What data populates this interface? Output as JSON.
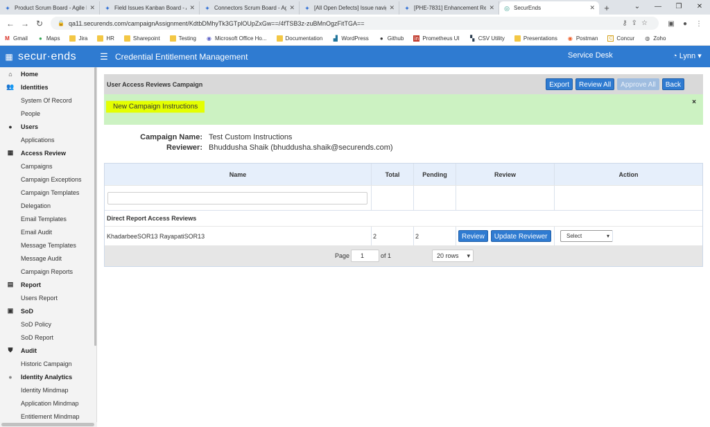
{
  "browser": {
    "tabs": [
      {
        "title": "Product Scrum Board - Agile Bo",
        "icon": "jira-icon"
      },
      {
        "title": "Field Issues Kanban Board - Agi",
        "icon": "jira-icon"
      },
      {
        "title": "Connectors Scrum Board - Agile",
        "icon": "jira-icon"
      },
      {
        "title": "[All Open Defects] Issue navigat",
        "icon": "jira-icon"
      },
      {
        "title": "[PHE-7831] Enhancement Reque",
        "icon": "jira-icon"
      },
      {
        "title": "SecurEnds",
        "icon": "securends-icon",
        "active": true
      }
    ],
    "url": "qa11.securends.com/campaignAssignment/KdtbDMhyTk3GTplOUpZxGw==/4fTSB3z-zuBMnOgzFitTGA==",
    "bookmarks": [
      "Gmail",
      "Maps",
      "Jira",
      "HR",
      "Sharepoint",
      "Testing",
      "Microsoft Office Ho...",
      "Documentation",
      "WordPress",
      "Github",
      "Prometheus UI",
      "CSV Utility",
      "Presentations",
      "Postman",
      "Concur",
      "Zoho"
    ]
  },
  "header": {
    "logo": "secur·ends",
    "title": "Credential Entitlement Management",
    "service_desk": "Service Desk",
    "user": "Lynn"
  },
  "sidebar": {
    "home": "Home",
    "identities": "Identities",
    "system_of_record": "System Of Record",
    "people": "People",
    "users": "Users",
    "applications": "Applications",
    "access_review": "Access Review",
    "campaigns": "Campaigns",
    "campaign_exceptions": "Campaign Exceptions",
    "campaign_templates": "Campaign Templates",
    "delegation": "Delegation",
    "email_templates": "Email Templates",
    "email_audit": "Email Audit",
    "message_templates": "Message Templates",
    "message_audit": "Message Audit",
    "campaign_reports": "Campaign Reports",
    "report": "Report",
    "users_report": "Users Report",
    "sod": "SoD",
    "sod_policy": "SoD Policy",
    "sod_report": "SoD Report",
    "audit": "Audit",
    "historic_campaign": "Historic Campaign",
    "identity_analytics": "Identity Analytics",
    "identity_mindmap": "Identity Mindmap",
    "application_mindmap": "Application Mindmap",
    "entitlement_mindmap": "Entitlement Mindmap"
  },
  "panel": {
    "title": "User Access Reviews Campaign",
    "export": "Export",
    "review_all": "Review All",
    "approve_all": "Approve All",
    "back": "Back"
  },
  "instructions": {
    "label": "New Campaign Instructions",
    "close": "×"
  },
  "campaign": {
    "name_label": "Campaign Name:",
    "name_value": "Test Custom Instructions",
    "reviewer_label": "Reviewer:",
    "reviewer_value": "Bhuddusha Shaik (bhuddusha.shaik@securends.com)"
  },
  "table": {
    "columns": [
      "Name",
      "Total",
      "Pending",
      "Review",
      "Action"
    ],
    "group": "Direct Report Access Reviews",
    "row": {
      "name": "KhadarbeeSOR13 RayapatiSOR13",
      "total": "2",
      "pending": "2",
      "review_btn": "Review",
      "update_btn": "Update Reviewer",
      "action_select": "Select"
    },
    "pager": {
      "page_label": "Page",
      "page_value": "1",
      "of_label": "of 1",
      "rows_select": "20 rows"
    }
  }
}
